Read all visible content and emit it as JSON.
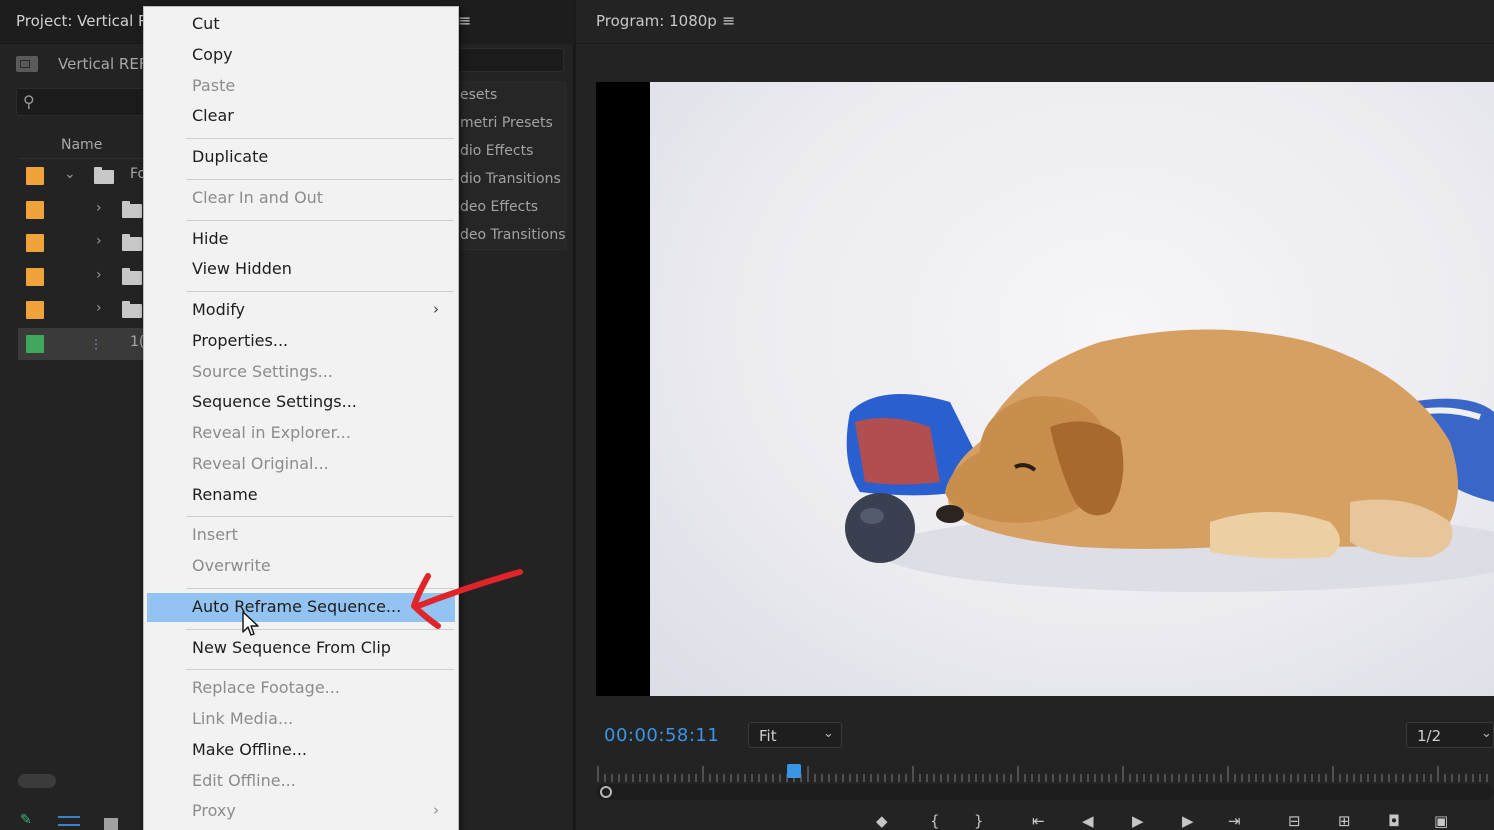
{
  "project": {
    "title": "Project: Vertical R",
    "bin_name": "Vertical REF",
    "column_name": "Name",
    "rows": [
      {
        "color": "#f0a33a",
        "type": "folder",
        "expanded": true,
        "label": "Fo"
      },
      {
        "color": "#f0a33a",
        "type": "folder",
        "expanded": false,
        "label": ""
      },
      {
        "color": "#f0a33a",
        "type": "folder",
        "expanded": false,
        "label": ""
      },
      {
        "color": "#f0a33a",
        "type": "folder",
        "expanded": false,
        "label": ""
      },
      {
        "color": "#f0a33a",
        "type": "folder",
        "expanded": false,
        "label": ""
      },
      {
        "color": "#3fa85c",
        "type": "sequence",
        "expanded": false,
        "label": "1("
      }
    ]
  },
  "effects": {
    "items": [
      "esets",
      "metri Presets",
      "dio Effects",
      "dio Transitions",
      "deo Effects",
      "deo Transitions"
    ]
  },
  "program": {
    "title": "Program: 1080p",
    "timecode": "00:00:58:11",
    "zoom": "Fit",
    "resolution": "1/2",
    "playhead_fraction": 0.22
  },
  "menu": {
    "items": [
      {
        "label": "Cut",
        "enabled": true
      },
      {
        "label": "Copy",
        "enabled": true
      },
      {
        "label": "Paste",
        "enabled": false
      },
      {
        "label": "Clear",
        "enabled": true
      },
      {
        "separator": true
      },
      {
        "label": "Duplicate",
        "enabled": true
      },
      {
        "separator": true
      },
      {
        "label": "Clear In and Out",
        "enabled": false
      },
      {
        "separator": true
      },
      {
        "label": "Hide",
        "enabled": true
      },
      {
        "label": "View Hidden",
        "enabled": true
      },
      {
        "separator": true
      },
      {
        "label": "Modify",
        "enabled": true,
        "submenu": true
      },
      {
        "label": "Properties...",
        "enabled": true
      },
      {
        "label": "Source Settings...",
        "enabled": false
      },
      {
        "label": "Sequence Settings...",
        "enabled": true
      },
      {
        "label": "Reveal in Explorer...",
        "enabled": false
      },
      {
        "label": "Reveal Original...",
        "enabled": false
      },
      {
        "label": "Rename",
        "enabled": true
      },
      {
        "separator": true
      },
      {
        "label": "Insert",
        "enabled": false
      },
      {
        "label": "Overwrite",
        "enabled": false
      },
      {
        "separator": true
      },
      {
        "label": "Auto Reframe Sequence...",
        "enabled": true,
        "highlighted": true
      },
      {
        "separator": true
      },
      {
        "label": "New Sequence From Clip",
        "enabled": true
      },
      {
        "separator": true
      },
      {
        "label": "Replace Footage...",
        "enabled": false
      },
      {
        "label": "Link Media...",
        "enabled": false
      },
      {
        "label": "Make Offline...",
        "enabled": true
      },
      {
        "label": "Edit Offline...",
        "enabled": false
      },
      {
        "label": "Proxy",
        "enabled": false,
        "submenu": true
      }
    ]
  },
  "colors": {
    "accent": "#3a95e6",
    "menu_highlight": "#93c3f0",
    "annotation": "#e0242a"
  },
  "icons": {
    "project_search": "search-icon",
    "panel_menu": "hamburger-menu-icon",
    "submenu": "chevron-right-icon",
    "cursor": "mouse-pointer-icon",
    "annotation": "red-arrow-icon"
  }
}
